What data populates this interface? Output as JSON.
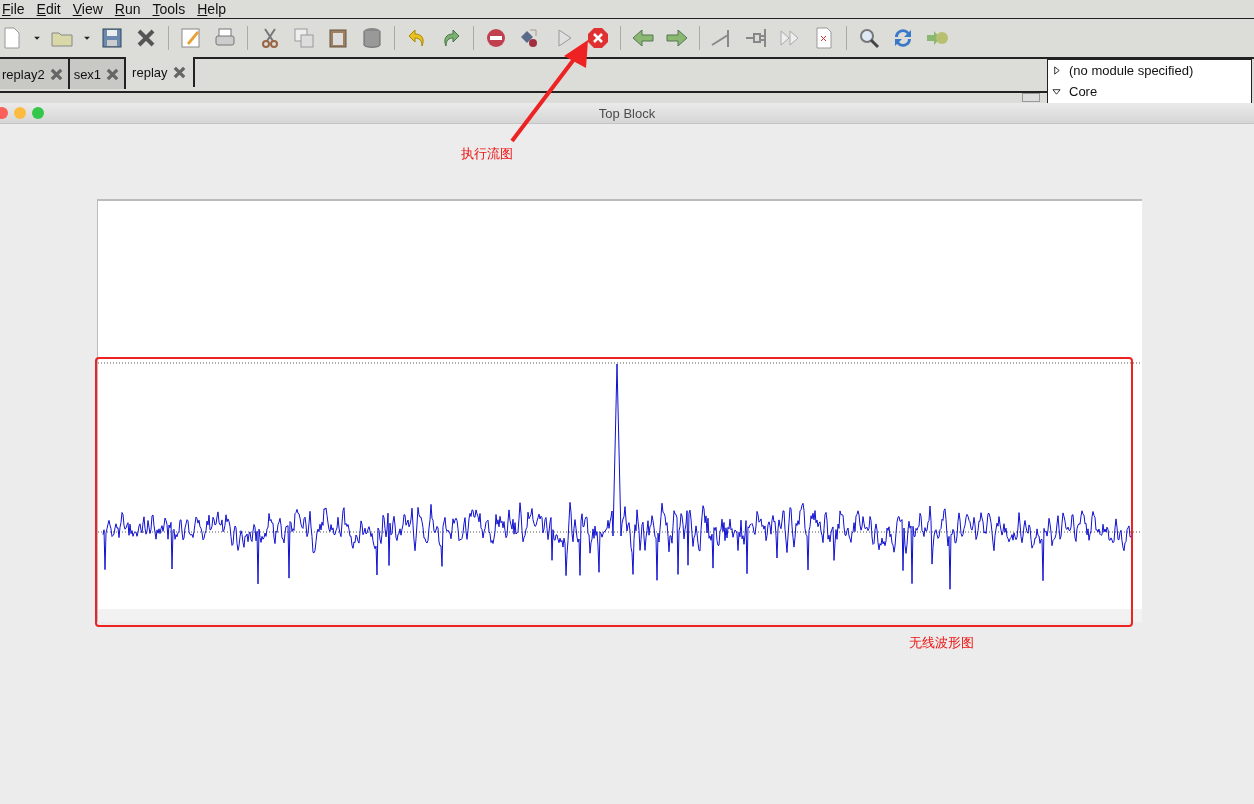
{
  "menu": [
    "File",
    "Edit",
    "View",
    "Run",
    "Tools",
    "Help"
  ],
  "tabs": [
    {
      "label": "replay2",
      "selected": false
    },
    {
      "label": "sex1",
      "selected": false
    },
    {
      "label": "replay",
      "selected": true
    }
  ],
  "block_tree": [
    {
      "label": "(no module specified)",
      "expanded": false
    },
    {
      "label": "Core",
      "expanded": true
    }
  ],
  "window": {
    "title": "Top Block"
  },
  "annotations": [
    {
      "kind": "arrow",
      "label": "执行流图"
    },
    {
      "kind": "box",
      "label": "无线波形图"
    }
  ]
}
